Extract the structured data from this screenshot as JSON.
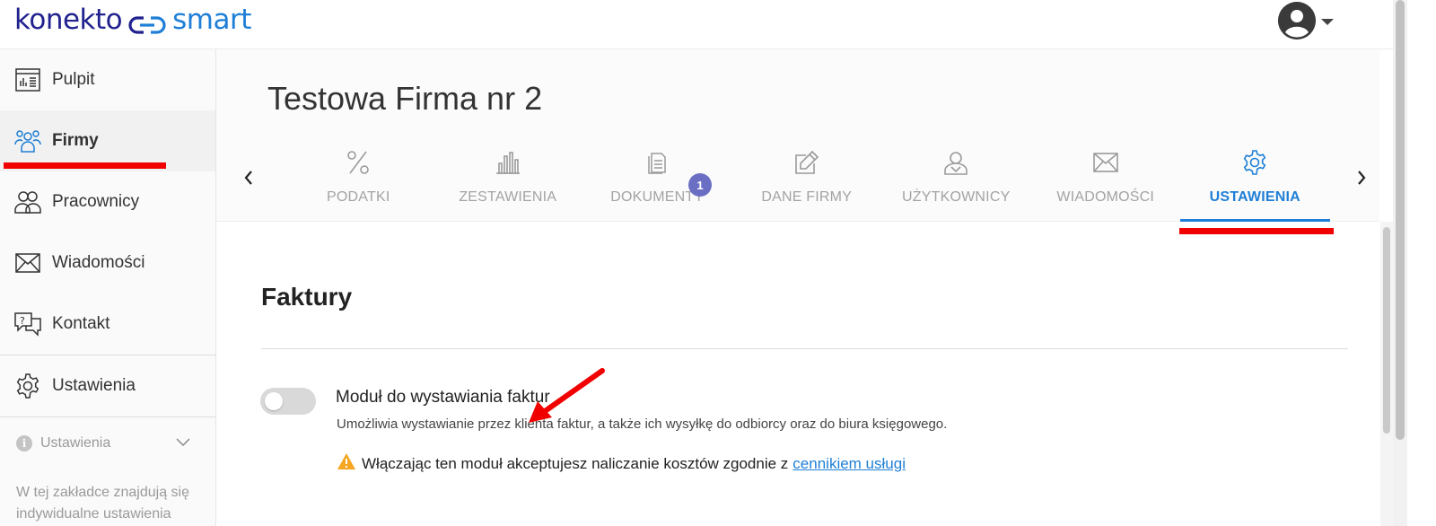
{
  "header": {
    "logo_brand": "konekto",
    "logo_product": "smart",
    "user_icon": "user-avatar-icon"
  },
  "sidebar": {
    "items": [
      {
        "label": "Pulpit",
        "icon": "dashboard-icon"
      },
      {
        "label": "Firmy",
        "icon": "companies-icon",
        "active": true
      },
      {
        "label": "Pracownicy",
        "icon": "employees-icon"
      },
      {
        "label": "Wiadomości",
        "icon": "envelope-icon"
      },
      {
        "label": "Kontakt",
        "icon": "help-chat-icon"
      },
      {
        "label": "Ustawienia",
        "icon": "gear-icon"
      }
    ],
    "info": {
      "label": "Ustawienia",
      "text": "W tej zakładce znajdują się indywidualne ustawienia"
    }
  },
  "company": {
    "title": "Testowa Firma nr 2"
  },
  "tabs": [
    {
      "label": "PODATKI",
      "icon": "percent-icon"
    },
    {
      "label": "ZESTAWIENIA",
      "icon": "bar-chart-icon"
    },
    {
      "label": "DOKUMENTY",
      "icon": "documents-icon",
      "badge": "1"
    },
    {
      "label": "DANE FIRMY",
      "icon": "edit-icon"
    },
    {
      "label": "UŻYTKOWNICY",
      "icon": "user-icon"
    },
    {
      "label": "WIADOMOŚCI",
      "icon": "envelope-icon"
    },
    {
      "label": "USTAWIENIA",
      "icon": "gear-icon",
      "active": true
    }
  ],
  "settings": {
    "section_title": "Faktury",
    "module": {
      "title": "Moduł do wystawiania faktur",
      "description": "Umożliwia wystawianie przez klienta faktur, a także ich wysyłkę do odbiorcy oraz do biura księgowego.",
      "enabled": false,
      "warning_text": "Włączając ten moduł akceptujesz naliczanie kosztów zgodnie z",
      "warning_link": "cennikiem usługi"
    }
  },
  "colors": {
    "accent": "#1f7fd6",
    "brand_dark": "#22228f",
    "annotation_red": "#f10000",
    "badge": "#6b6fc4",
    "warning": "#f5a623"
  }
}
